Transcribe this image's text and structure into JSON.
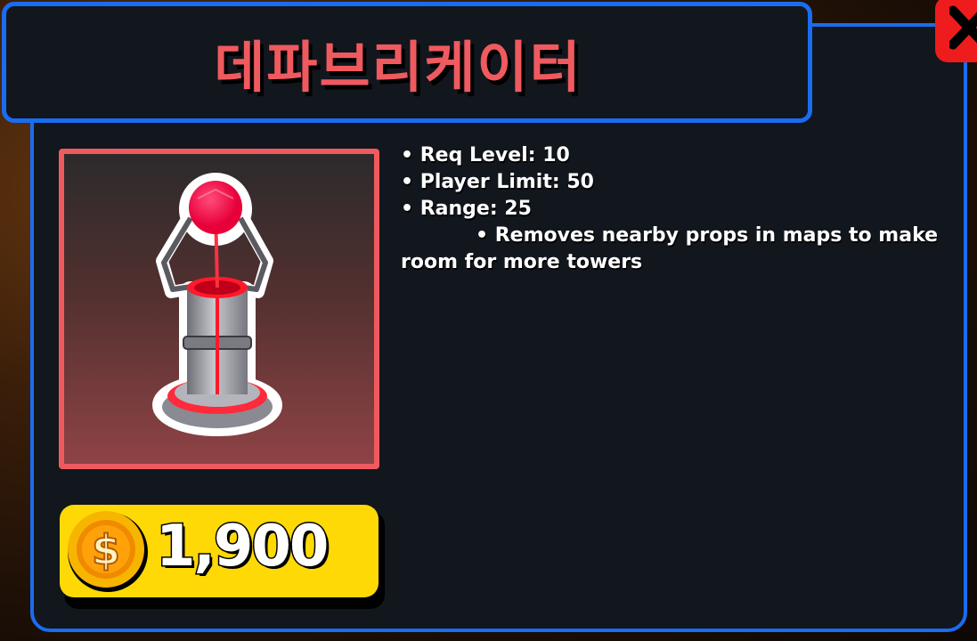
{
  "tower": {
    "name": "데파브리케이터"
  },
  "stats": {
    "req_level": "• Req Level: 10",
    "player_limit": "• Player Limit: 50",
    "range": "• Range: 25",
    "description": "• Removes nearby props in maps to make room for more towers"
  },
  "price": {
    "amount": "1,900",
    "currency_icon": "coin-dollar-icon"
  },
  "close": {
    "icon": "close-x-icon"
  },
  "colors": {
    "accent_border": "#1a6cf0",
    "title_red": "#ef5a5f",
    "close_red": "#ee1c1c",
    "price_yellow": "#ffd906",
    "panel_bg": "#12161d"
  }
}
